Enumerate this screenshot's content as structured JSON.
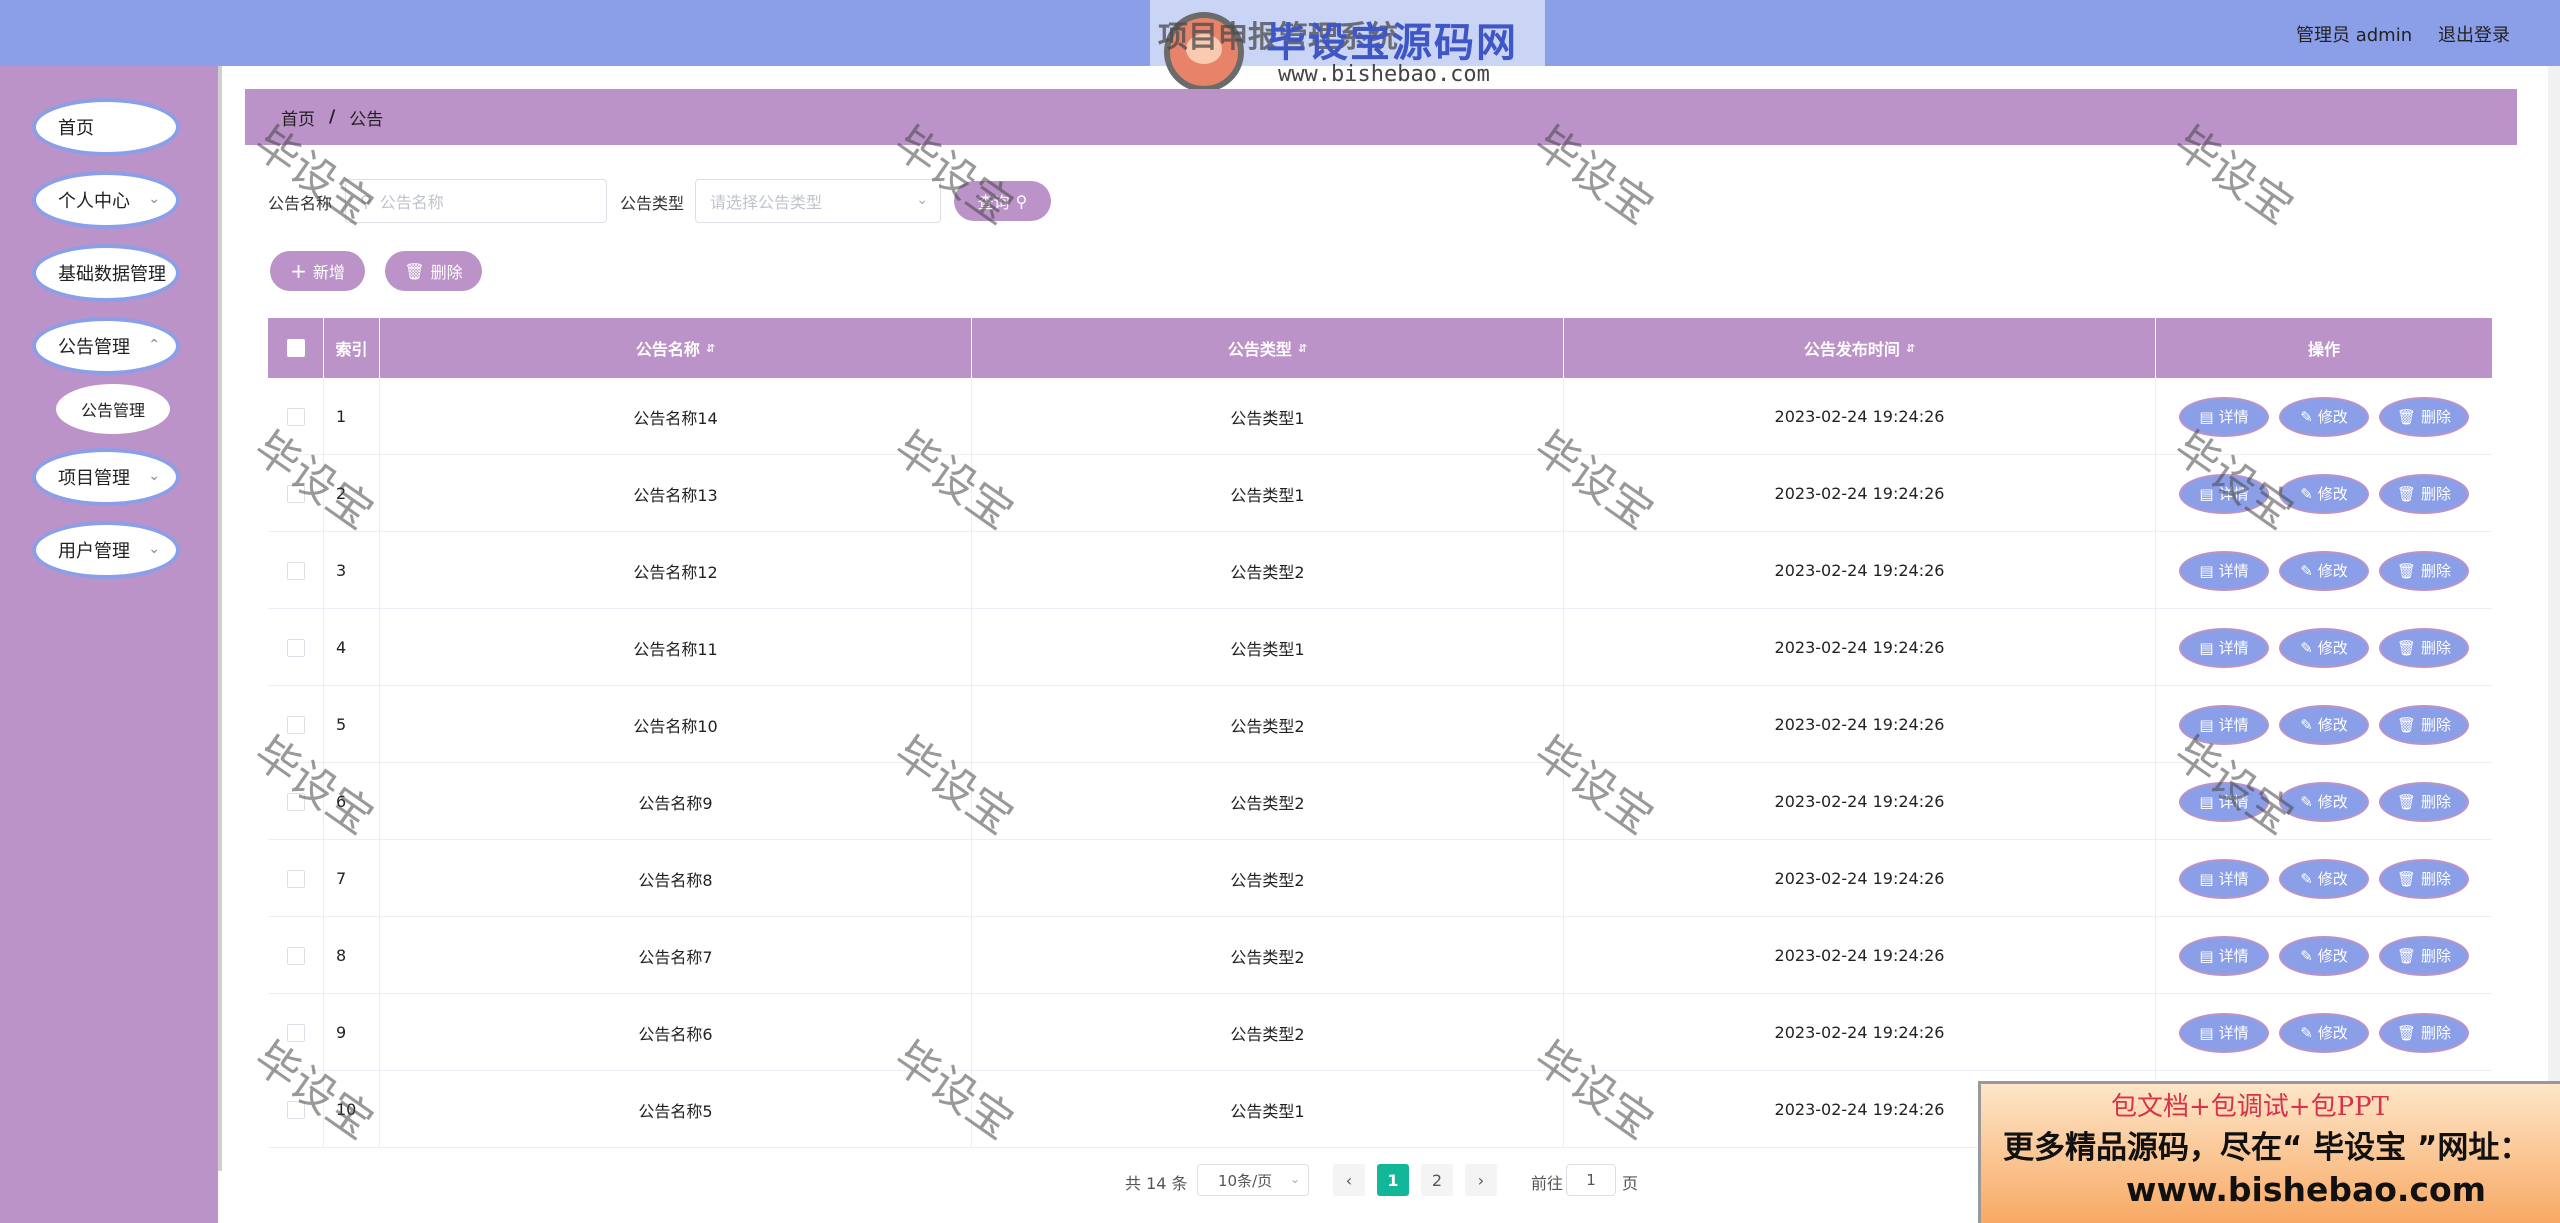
{
  "header": {
    "site_title": "项目申报管理系统",
    "logo_brand": "毕设宝源码网",
    "logo_url": "www.bishebao.com",
    "admin_label": "管理员 admin",
    "logout_label": "退出登录",
    "bg_color": "#8b9fe8"
  },
  "sidebar": {
    "bg_color": "#bb93c8",
    "items": [
      {
        "label": "首页",
        "icon": ""
      },
      {
        "label": "个人中心",
        "icon": "chevron-down-icon"
      },
      {
        "label": "基础数据管理",
        "icon": ""
      },
      {
        "label": "公告管理",
        "icon": "chevron-down-icon"
      },
      {
        "label": "项目管理",
        "icon": "chevron-down-icon"
      },
      {
        "label": "用户管理",
        "icon": "chevron-down-icon"
      }
    ],
    "submenu": {
      "label": "公告管理"
    }
  },
  "breadcrumb": {
    "home": "首页",
    "separator": "/",
    "current": "公告"
  },
  "search": {
    "name_label": "公告名称",
    "name_placeholder": "公告名称",
    "type_label": "公告类型",
    "type_placeholder": "请选择公告类型",
    "query_label": "查询"
  },
  "actions": {
    "add_label": "新增",
    "delete_label": "删除"
  },
  "table": {
    "headers": [
      "索引",
      "公告名称",
      "公告类型",
      "公告发布时间",
      "操作"
    ],
    "op_labels": {
      "detail": "详情",
      "edit": "修改",
      "delete": "删除"
    },
    "rows": [
      {
        "index": "1",
        "name": "公告名称14",
        "type": "公告类型1",
        "time": "2023-02-24 19:24:26"
      },
      {
        "index": "2",
        "name": "公告名称13",
        "type": "公告类型1",
        "time": "2023-02-24 19:24:26"
      },
      {
        "index": "3",
        "name": "公告名称12",
        "type": "公告类型2",
        "time": "2023-02-24 19:24:26"
      },
      {
        "index": "4",
        "name": "公告名称11",
        "type": "公告类型1",
        "time": "2023-02-24 19:24:26"
      },
      {
        "index": "5",
        "name": "公告名称10",
        "type": "公告类型2",
        "time": "2023-02-24 19:24:26"
      },
      {
        "index": "6",
        "name": "公告名称9",
        "type": "公告类型2",
        "time": "2023-02-24 19:24:26"
      },
      {
        "index": "7",
        "name": "公告名称8",
        "type": "公告类型2",
        "time": "2023-02-24 19:24:26"
      },
      {
        "index": "8",
        "name": "公告名称7",
        "type": "公告类型2",
        "time": "2023-02-24 19:24:26"
      },
      {
        "index": "9",
        "name": "公告名称6",
        "type": "公告类型2",
        "time": "2023-02-24 19:24:26"
      },
      {
        "index": "10",
        "name": "公告名称5",
        "type": "公告类型1",
        "time": "2023-02-24 19:24:26"
      }
    ]
  },
  "pagination": {
    "total_text": "共 14 条",
    "page_size": "10条/页",
    "pages": [
      "1",
      "2"
    ],
    "current_page": "1",
    "goto_prefix": "前往",
    "goto_value": "1",
    "goto_suffix": "页"
  },
  "watermark_text": "毕设宝",
  "ad": {
    "line1": "包文档+包调试+包PPT",
    "line2": "更多精品源码，尽在“ 毕设宝 ”网址：",
    "line3": "www.bishebao.com"
  },
  "colors": {
    "accent_purple": "#bb93c8",
    "accent_blue": "#8b9fe8",
    "page_active": "#12b79a"
  }
}
